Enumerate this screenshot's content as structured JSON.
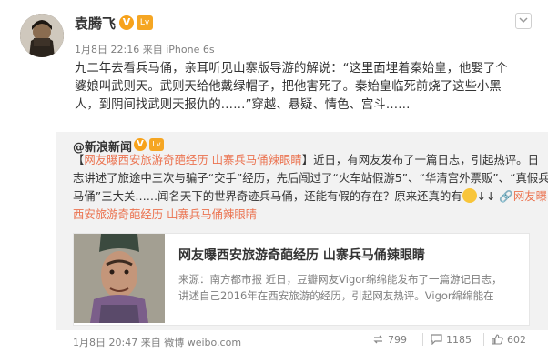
{
  "post": {
    "author": "袁腾飞",
    "verified_badge": "V",
    "level_badge": "Lv",
    "date": "1月8日 22:16",
    "source_prefix": "来自",
    "source": "iPhone 6s",
    "lines": [
      "九二年去看兵马俑，亲耳听见山寨版导游的解说：“这里面埋着秦始皇，他娶了个",
      "婆娘叫武则天。武则天给他戴绿帽子，把他害死了。秦始皇临死前烧了这些小黑",
      "人，到阴间找武则天报仇的……”穿越、悬疑、情色、宫斗……"
    ]
  },
  "repost": {
    "author": "@新浪新闻",
    "verified_badge": "V",
    "level_badge": "Lv",
    "line1_prefix": "【",
    "line1_topic": "网友曝西安旅游奇葩经历 山寨兵马俑辣眼睛",
    "line1_rest": "】近日，有网友发布了一篇日志，引起热评。日",
    "line2": "志讲述了旅途中三次与骗子“交手”经历，先后闯过了“火车站假游5”、“华清宫外票贩”、“真假兵",
    "line3": "马俑”三大关……闻名天下的世界奇迹兵马俑，还能有假的存在？原来还真的有",
    "line3_arrows": "↓↓",
    "line3_link": "网友曝",
    "line4_link": "西安旅游奇葩经历 山寨兵马俑辣眼睛",
    "card": {
      "title": "网友曝西安旅游奇葩经历 山寨兵马俑辣眼睛",
      "desc_line1": "来源：南方都市报 近日，豆瓣网友Vigor绵绵能发布了一篇游记日志，",
      "desc_line2": "讲述自己2016年在西安旅游的经历，引起网友热评。Vigor绵绵能在"
    },
    "date": "1月8日 20:47",
    "source_prefix": "来自",
    "source": "微博 weibo.com",
    "repost_count": "799",
    "comment_count": "1185",
    "like_count": "602"
  },
  "colors": {
    "link": "#eb7350",
    "muted": "#808080",
    "repost_bg": "#f2f2f2",
    "badge": "#f7a21b"
  },
  "icons": [
    "avatar-image",
    "chevron-down-icon",
    "verified-icon",
    "level-icon",
    "smiley-icon",
    "link-icon",
    "repost-icon",
    "comment-icon",
    "like-icon"
  ]
}
